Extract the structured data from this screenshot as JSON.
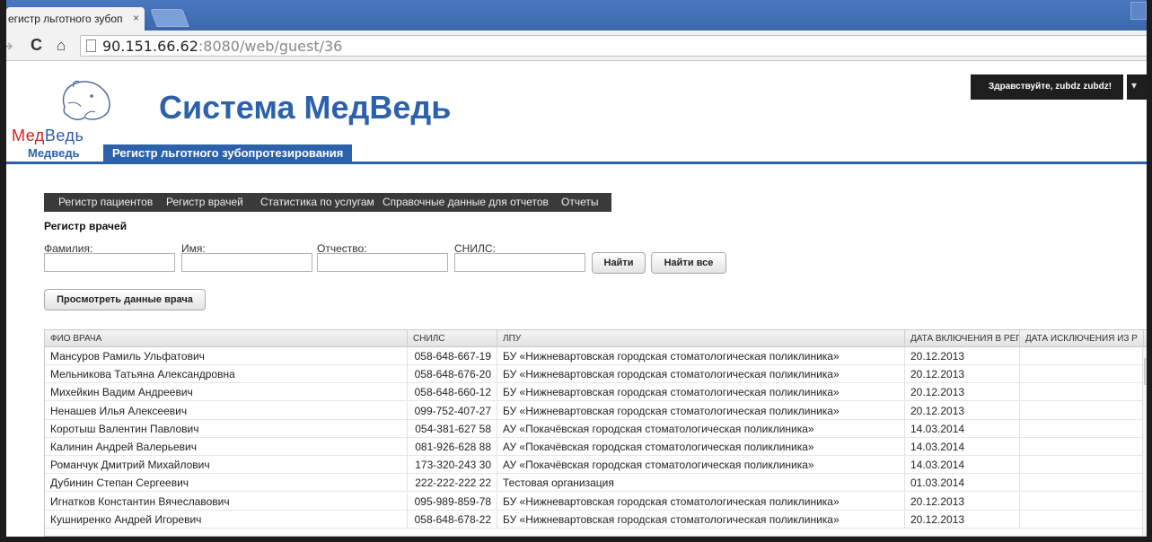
{
  "browser": {
    "tab_title": "егистр льготного зубоп",
    "tab_close": "×",
    "url_host": "90.151.66.62",
    "url_rest": ":8080/web/guest/36"
  },
  "site": {
    "logo_text_red": "Мед",
    "logo_text_blue": "Ведь",
    "title": "Система МедВедь",
    "greeting": "Здравствуйте, zubdz zubdz!"
  },
  "topnav": {
    "home": "Медведь",
    "active": "Регистр льготного зубопротезирования"
  },
  "submenu": [
    "Регистр пациентов",
    "Регистр врачей",
    "Статистика по услугам",
    "Справочные данные для отчетов",
    "Отчеты"
  ],
  "search": {
    "title": "Регистр врачей",
    "labels": [
      "Фамилия:",
      "Имя:",
      "Отчество:",
      "СНИЛС:"
    ],
    "values": [
      "",
      "",
      "",
      ""
    ],
    "find_button": "Найти",
    "find_all_button": "Найти все",
    "view_button": "Просмотреть данные врача"
  },
  "grid": {
    "columns": [
      "ФИО ВРАЧА",
      "СНИЛС",
      "ЛПУ",
      "ДАТА ВКЛЮЧЕНИЯ В РЕГ",
      "ДАТА ИСКЛЮЧЕНИЯ ИЗ Р"
    ],
    "rows": [
      [
        "Мансуров Рамиль Ульфатович",
        "058-648-667-19",
        "БУ «Нижневартовская городская стоматологическая поликлиника»",
        "20.12.2013",
        ""
      ],
      [
        "Мельникова Татьяна Александровна",
        "058-648-676-20",
        "БУ «Нижневартовская городская стоматологическая поликлиника»",
        "20.12.2013",
        ""
      ],
      [
        "Михейкин Вадим Андреевич",
        "058-648-660-12",
        "БУ «Нижневартовская городская стоматологическая поликлиника»",
        "20.12.2013",
        ""
      ],
      [
        "Ненашев Илья Алексеевич",
        "099-752-407-27",
        "БУ «Нижневартовская городская стоматологическая поликлиника»",
        "20.12.2013",
        ""
      ],
      [
        "Коротыш Валентин Павлович",
        "054-381-627 58",
        "АУ «Покачёвская городская стоматологическая поликлиника»",
        "14.03.2014",
        ""
      ],
      [
        "Калинин Андрей Валерьевич",
        "081-926-628 88",
        "АУ «Покачёвская городская стоматологическая поликлиника»",
        "14.03.2014",
        ""
      ],
      [
        "Романчук Дмитрий Михайлович",
        "173-320-243 30",
        "АУ «Покачёвская городская стоматологическая поликлиника»",
        "14.03.2014",
        ""
      ],
      [
        "Дубинин Степан Сергеевич",
        "222-222-222 22",
        "Тестовая организация",
        "01.03.2014",
        ""
      ],
      [
        "Игнатков Константин Вячеславович",
        "095-989-859-78",
        "БУ «Нижневартовская городская стоматологическая поликлиника»",
        "20.12.2013",
        ""
      ],
      [
        "Кушниренко Андрей Игоревич",
        "058-648-678-22",
        "БУ «Нижневартовская городская стоматологическая поликлиника»",
        "20.12.2013",
        ""
      ]
    ]
  }
}
